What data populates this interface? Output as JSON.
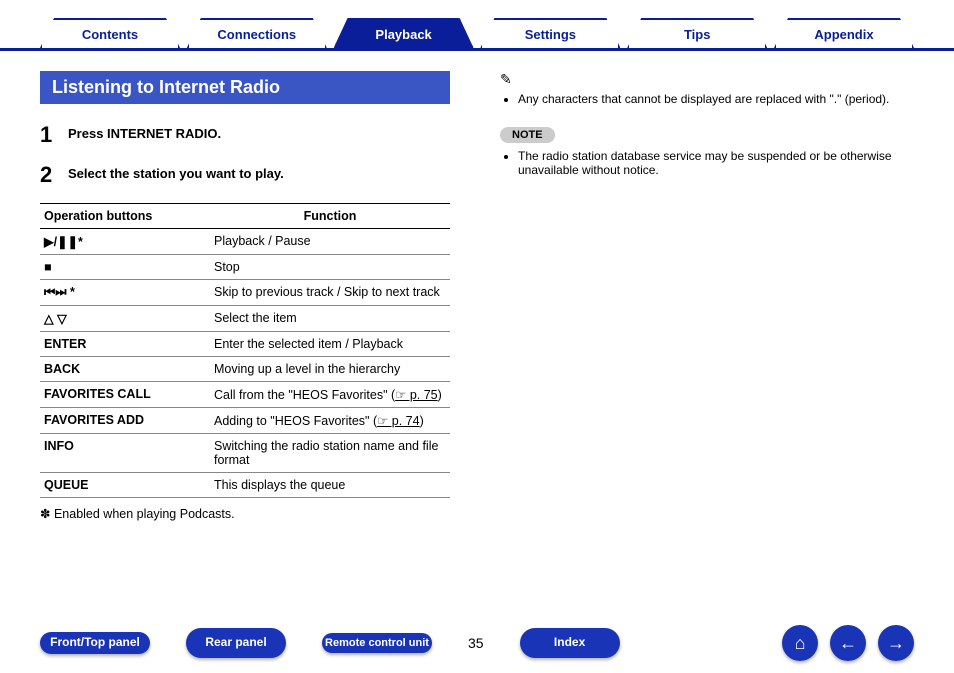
{
  "nav": {
    "tabs": [
      {
        "label": "Contents",
        "active": false
      },
      {
        "label": "Connections",
        "active": false
      },
      {
        "label": "Playback",
        "active": true
      },
      {
        "label": "Settings",
        "active": false
      },
      {
        "label": "Tips",
        "active": false
      },
      {
        "label": "Appendix",
        "active": false
      }
    ]
  },
  "section": {
    "title": "Listening to Internet Radio",
    "steps": [
      {
        "num": "1",
        "text": "Press INTERNET RADIO."
      },
      {
        "num": "2",
        "text": "Select the station you want to play."
      }
    ]
  },
  "table": {
    "headers": [
      "Operation buttons",
      "Function"
    ],
    "rows": [
      {
        "btn_icon": "play-pause",
        "btn_suffix": "*",
        "func": "Playback / Pause"
      },
      {
        "btn_icon": "stop",
        "btn_suffix": "",
        "func": "Stop"
      },
      {
        "btn_icon": "skip",
        "btn_suffix": " *",
        "func": "Skip to previous track / Skip to next track"
      },
      {
        "btn_icon": "updown",
        "btn_suffix": "",
        "func": "Select the item"
      },
      {
        "btn_text": "ENTER",
        "func": "Enter the selected item / Playback"
      },
      {
        "btn_text": "BACK",
        "func": "Moving up a level in the hierarchy"
      },
      {
        "btn_text": "FAVORITES CALL",
        "func_prefix": "Call from the \"HEOS Favorites\" (",
        "link": "☞ p. 75",
        "func_suffix": ")"
      },
      {
        "btn_text": "FAVORITES ADD",
        "func_prefix": "Adding to \"HEOS Favorites\" (",
        "link": "☞ p. 74",
        "func_suffix": ")"
      },
      {
        "btn_text": "INFO",
        "func": "Switching the radio station name and file format"
      },
      {
        "btn_text": "QUEUE",
        "func": "This displays the queue"
      }
    ],
    "footnote": "✽ Enabled when playing Podcasts."
  },
  "right": {
    "notes_top": [
      "Any characters that cannot be displayed are replaced with \".\" (period)."
    ],
    "note_label": "NOTE",
    "notes_bottom": [
      "The radio station database service may be suspended or be otherwise unavailable without notice."
    ]
  },
  "footer": {
    "buttons": [
      "Front/Top panel",
      "Rear panel",
      "Remote control unit",
      "Index"
    ],
    "page": "35"
  }
}
